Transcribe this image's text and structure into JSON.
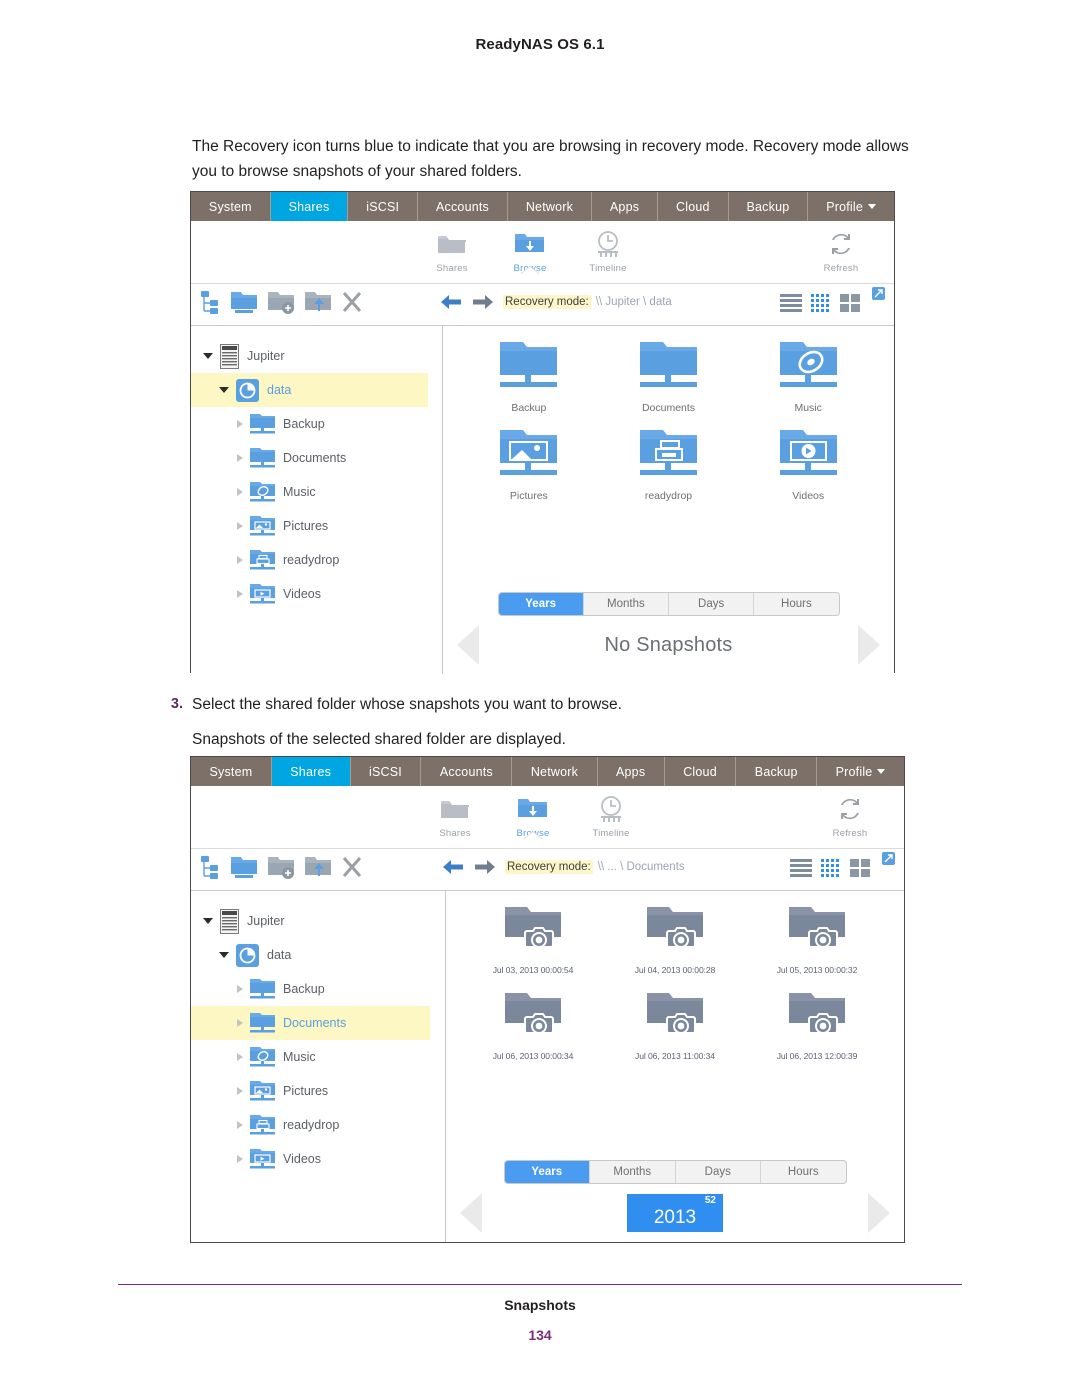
{
  "page": {
    "header_title": "ReadyNAS OS 6.1",
    "footer_title": "Snapshots",
    "page_number": "134"
  },
  "intro_paragraph": "The Recovery icon turns blue to indicate that you are browsing in recovery mode. Recovery mode allows you to browse snapshots of your shared folders.",
  "step": {
    "number": "3.",
    "text": "Select the shared folder whose snapshots you want to browse.",
    "result": "Snapshots of the selected shared folder are displayed."
  },
  "colors": {
    "nav_bg": "#7d7068",
    "nav_active": "#00a6e2",
    "accent_blue": "#5a9fe0",
    "highlight_yellow": "#fdf7c4",
    "snapshot_gray": "#7b879b",
    "page_accent": "#7b2d7b"
  },
  "nav_tabs": [
    {
      "label": "System",
      "active": false
    },
    {
      "label": "Shares",
      "active": true
    },
    {
      "label": "iSCSI",
      "active": false
    },
    {
      "label": "Accounts",
      "active": false
    },
    {
      "label": "Network",
      "active": false
    },
    {
      "label": "Apps",
      "active": false
    },
    {
      "label": "Cloud",
      "active": false
    },
    {
      "label": "Backup",
      "active": false
    },
    {
      "label": "Profile",
      "active": false,
      "has_caret": true
    }
  ],
  "icon_bar": [
    {
      "label": "Shares",
      "icon": "folder-icon",
      "active": false
    },
    {
      "label": "Browse",
      "icon": "folder-download-icon",
      "active": true
    },
    {
      "label": "Timeline",
      "icon": "clock-icon",
      "active": false
    },
    {
      "label": "Refresh",
      "icon": "refresh-icon",
      "active": false
    }
  ],
  "toolbar": {
    "left_icons": [
      "folder-tree-icon",
      "folder-open-icon",
      "new-folder-icon",
      "upload-folder-icon",
      "delete-x-icon"
    ],
    "back_icon": "arrow-left-icon",
    "forward_icon": "arrow-right-icon",
    "recovery_label": "Recovery mode:",
    "right_icons": [
      "list-view-icon",
      "detail-grid-icon",
      "tile-view-icon",
      "popout-icon"
    ]
  },
  "shot1": {
    "breadcrumb_path": "\\\\ Jupiter \\ data",
    "tree": [
      {
        "label": "Jupiter",
        "icon": "server-icon",
        "indent": 0,
        "expanded": true,
        "selected": false
      },
      {
        "label": "data",
        "icon": "volume-icon",
        "indent": 1,
        "expanded": true,
        "selected": true
      },
      {
        "label": "Backup",
        "icon": "share-folder-icon",
        "indent": 2,
        "expanded": false,
        "selected": false
      },
      {
        "label": "Documents",
        "icon": "share-folder-icon",
        "indent": 2,
        "expanded": false,
        "selected": false
      },
      {
        "label": "Music",
        "icon": "share-music-icon",
        "indent": 2,
        "expanded": false,
        "selected": false
      },
      {
        "label": "Pictures",
        "icon": "share-pictures-icon",
        "indent": 2,
        "expanded": false,
        "selected": false
      },
      {
        "label": "readydrop",
        "icon": "share-readydrop-icon",
        "indent": 2,
        "expanded": false,
        "selected": false
      },
      {
        "label": "Videos",
        "icon": "share-videos-icon",
        "indent": 2,
        "expanded": false,
        "selected": false
      }
    ],
    "folders": [
      {
        "label": "Backup",
        "icon": "share-folder-icon"
      },
      {
        "label": "Documents",
        "icon": "share-folder-icon"
      },
      {
        "label": "Music",
        "icon": "share-music-icon"
      },
      {
        "label": "Pictures",
        "icon": "share-pictures-icon"
      },
      {
        "label": "readydrop",
        "icon": "share-readydrop-icon"
      },
      {
        "label": "Videos",
        "icon": "share-videos-icon"
      }
    ],
    "timeline": {
      "segments": [
        {
          "label": "Years",
          "active": true
        },
        {
          "label": "Months",
          "active": false
        },
        {
          "label": "Days",
          "active": false
        },
        {
          "label": "Hours",
          "active": false
        }
      ],
      "empty_message": "No Snapshots"
    }
  },
  "shot2": {
    "breadcrumb_path": "\\\\ ... \\ Documents",
    "tree": [
      {
        "label": "Jupiter",
        "icon": "server-icon",
        "indent": 0,
        "expanded": true,
        "selected": false
      },
      {
        "label": "data",
        "icon": "volume-icon",
        "indent": 1,
        "expanded": true,
        "selected": false
      },
      {
        "label": "Backup",
        "icon": "share-folder-icon",
        "indent": 2,
        "expanded": false,
        "selected": false
      },
      {
        "label": "Documents",
        "icon": "share-folder-icon",
        "indent": 2,
        "expanded": false,
        "selected": true
      },
      {
        "label": "Music",
        "icon": "share-music-icon",
        "indent": 2,
        "expanded": false,
        "selected": false
      },
      {
        "label": "Pictures",
        "icon": "share-pictures-icon",
        "indent": 2,
        "expanded": false,
        "selected": false
      },
      {
        "label": "readydrop",
        "icon": "share-readydrop-icon",
        "indent": 2,
        "expanded": false,
        "selected": false
      },
      {
        "label": "Videos",
        "icon": "share-videos-icon",
        "indent": 2,
        "expanded": false,
        "selected": false
      }
    ],
    "snapshots": [
      {
        "label": "Jul 03, 2013 00:00:54",
        "icon": "snapshot-folder-icon"
      },
      {
        "label": "Jul 04, 2013 00:00:28",
        "icon": "snapshot-folder-icon"
      },
      {
        "label": "Jul 05, 2013 00:00:32",
        "icon": "snapshot-folder-icon"
      },
      {
        "label": "Jul 06, 2013 00:00:34",
        "icon": "snapshot-folder-icon"
      },
      {
        "label": "Jul 06, 2013 11:00:34",
        "icon": "snapshot-folder-icon"
      },
      {
        "label": "Jul 06, 2013 12:00:39",
        "icon": "snapshot-folder-icon"
      }
    ],
    "timeline": {
      "segments": [
        {
          "label": "Years",
          "active": true
        },
        {
          "label": "Months",
          "active": false
        },
        {
          "label": "Days",
          "active": false
        },
        {
          "label": "Hours",
          "active": false
        }
      ],
      "year_chip": {
        "year": "2013",
        "count": "52"
      }
    }
  }
}
